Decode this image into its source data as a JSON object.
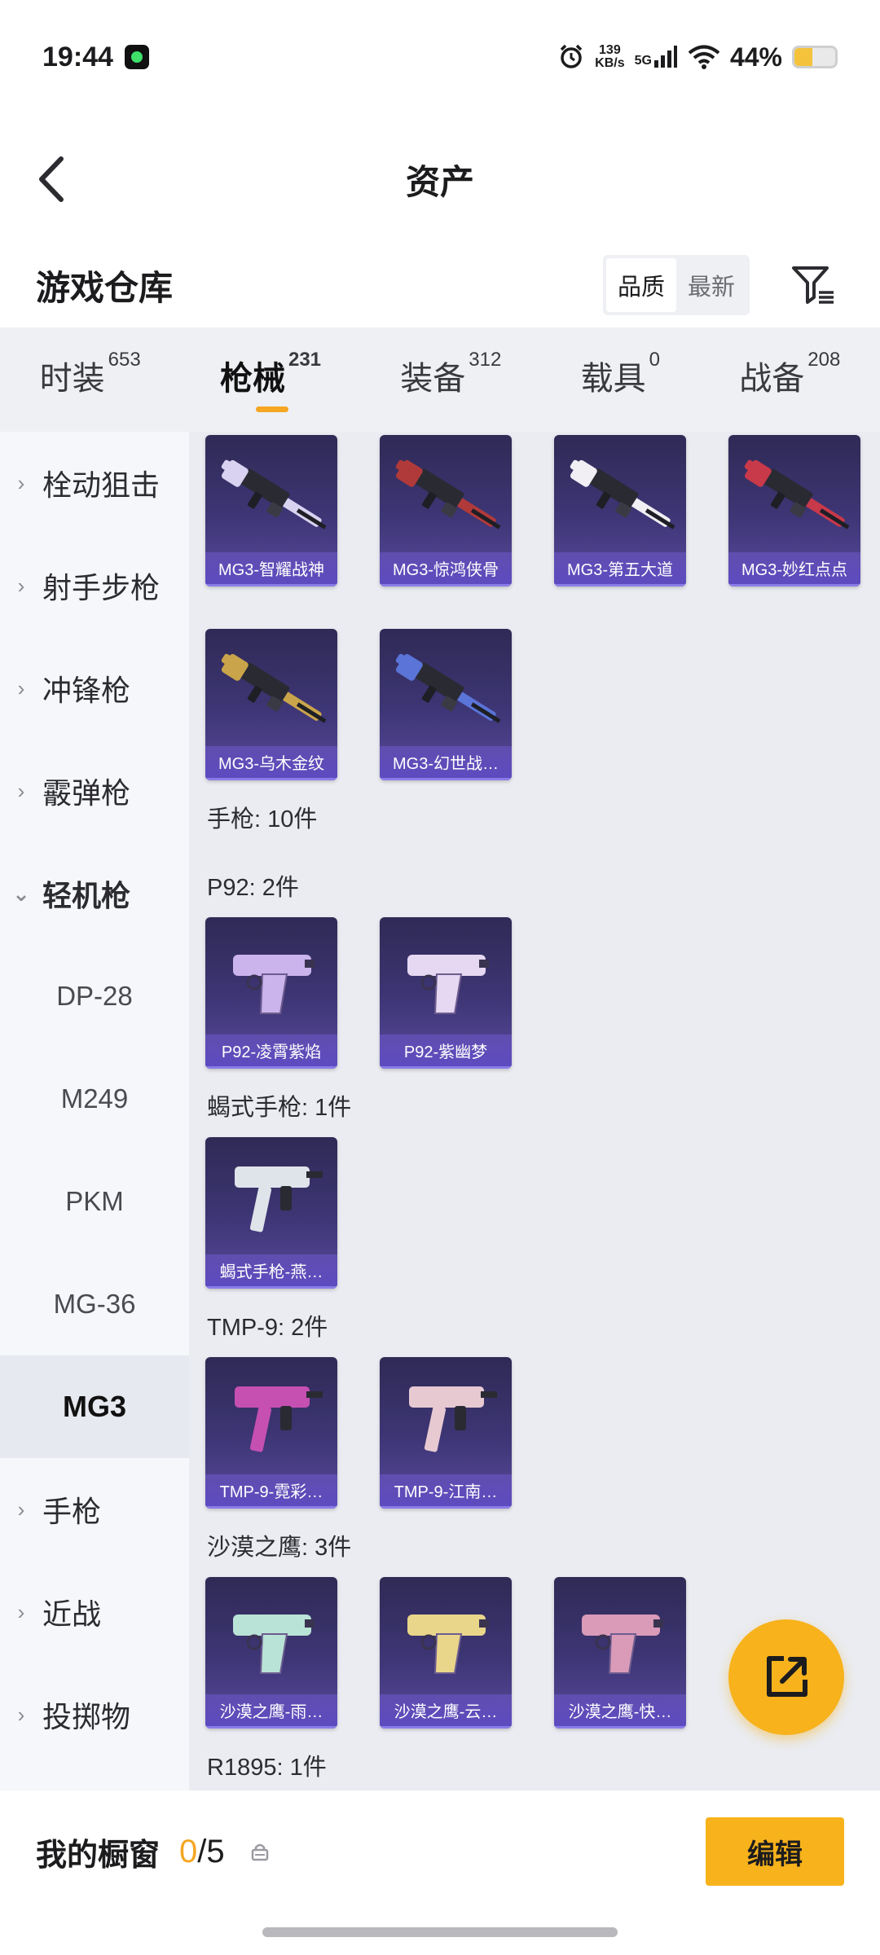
{
  "status_bar": {
    "time": "19:44",
    "net_speed_value": "139",
    "net_speed_unit": "KB/s",
    "net_type": "5G",
    "battery": "44%",
    "battery_level": 0.44
  },
  "header": {
    "title": "资产"
  },
  "warehouse": {
    "title": "游戏仓库",
    "sort_options": [
      "品质",
      "最新"
    ],
    "active_sort": "品质"
  },
  "tabs": [
    {
      "label": "时装",
      "count": "653"
    },
    {
      "label": "枪械",
      "count": "231",
      "active": true
    },
    {
      "label": "装备",
      "count": "312"
    },
    {
      "label": "载具",
      "count": "0"
    },
    {
      "label": "战备",
      "count": "208"
    }
  ],
  "sidebar": {
    "items": [
      {
        "label": "栓动狙击",
        "type": "collapsed"
      },
      {
        "label": "射手步枪",
        "type": "collapsed"
      },
      {
        "label": "冲锋枪",
        "type": "collapsed"
      },
      {
        "label": "霰弹枪",
        "type": "collapsed"
      },
      {
        "label": "轻机枪",
        "type": "expanded"
      },
      {
        "label": "DP-28",
        "type": "sub"
      },
      {
        "label": "M249",
        "type": "sub"
      },
      {
        "label": "PKM",
        "type": "sub"
      },
      {
        "label": "MG-36",
        "type": "sub"
      },
      {
        "label": "MG3",
        "type": "selected"
      },
      {
        "label": "手枪",
        "type": "collapsed"
      },
      {
        "label": "近战",
        "type": "collapsed"
      },
      {
        "label": "投掷物",
        "type": "collapsed"
      }
    ]
  },
  "content": {
    "groups": [
      {
        "title": "手枪: 10件"
      },
      {
        "title": "P92: 2件"
      },
      {
        "title": "蝎式手枪: 1件"
      },
      {
        "title": "TMP-9: 2件"
      },
      {
        "title": "沙漠之鹰: 3件"
      },
      {
        "title": "R1895: 1件"
      }
    ],
    "items": {
      "mg3_row1": [
        "MG3-智耀战神",
        "MG3-惊鸿侠骨",
        "MG3-第五大道",
        "MG3-妙红点点"
      ],
      "mg3_row2": [
        "MG3-乌木金纹",
        "MG3-幻世战…"
      ],
      "p92": [
        "P92-凌霄紫焰",
        "P92-紫幽梦"
      ],
      "scorpion": [
        "蝎式手枪-燕…"
      ],
      "tmp9": [
        "TMP-9-霓彩…",
        "TMP-9-江南…"
      ],
      "deagle": [
        "沙漠之鹰-雨…",
        "沙漠之鹰-云…",
        "沙漠之鹰-快…"
      ]
    }
  },
  "bottom_bar": {
    "title": "我的橱窗",
    "current": "0",
    "separator": "/",
    "total": "5",
    "edit_label": "编辑"
  },
  "colors": {
    "accent": "#f7b21c",
    "tab_bg": "#eef0f4",
    "card_bg": "#3e3676"
  }
}
